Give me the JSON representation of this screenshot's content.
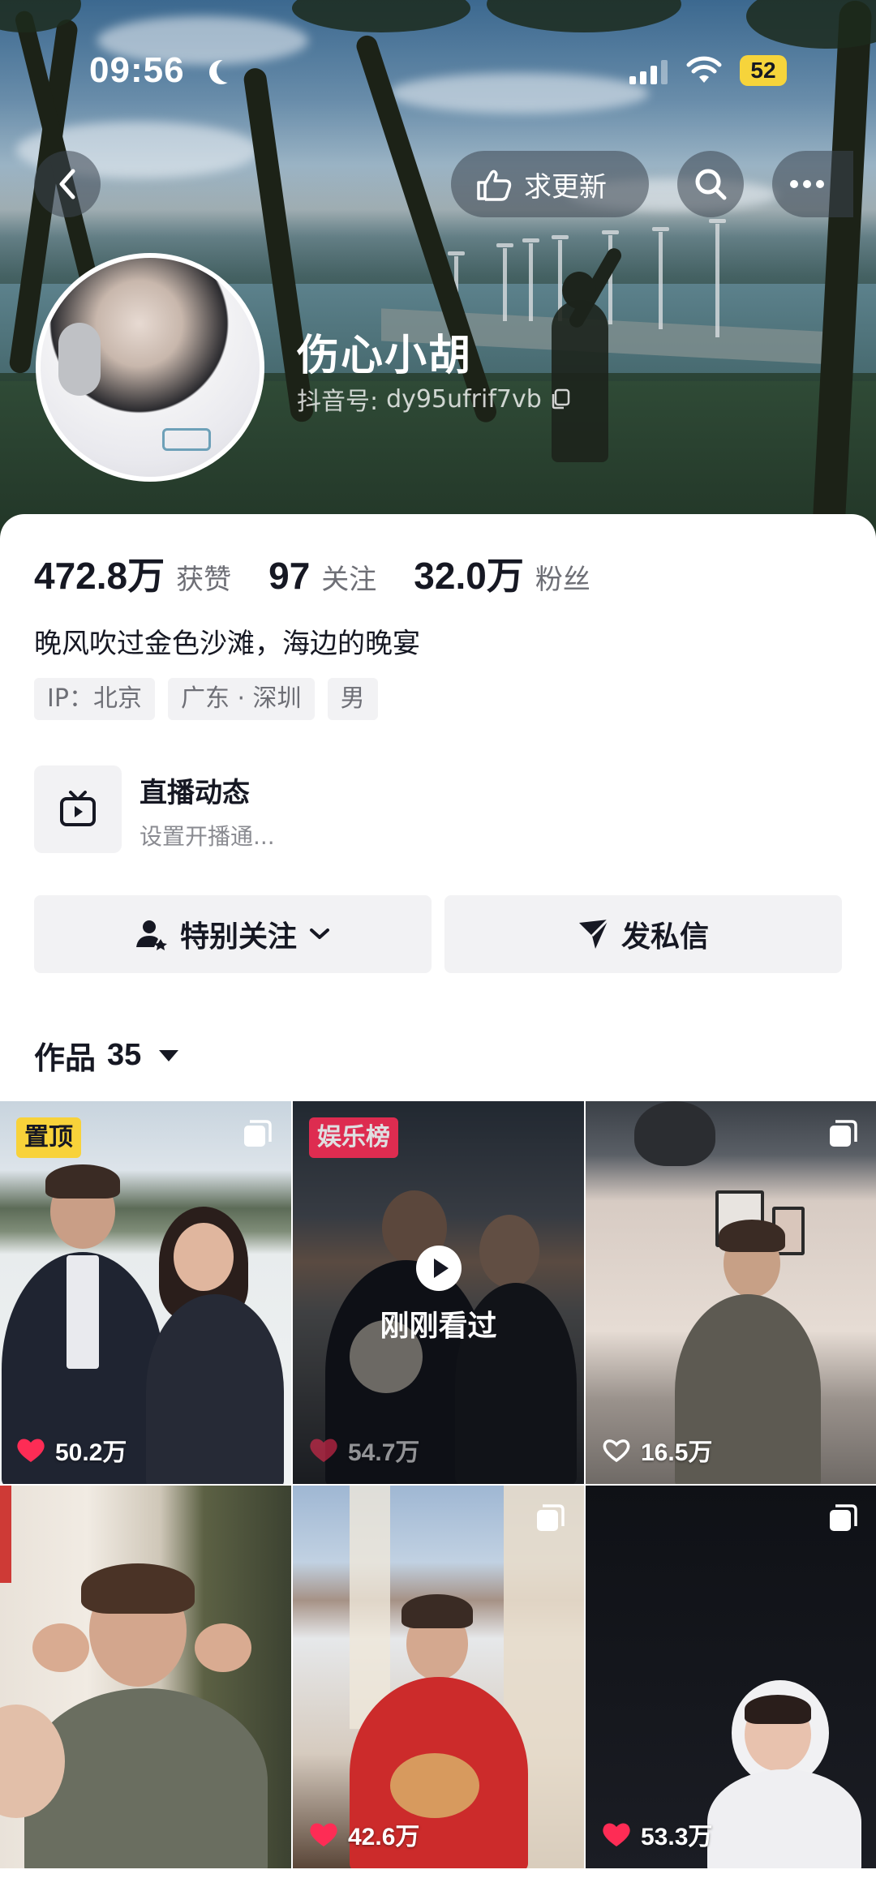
{
  "status_bar": {
    "time": "09:56",
    "battery": "52"
  },
  "header": {
    "update_button_label": "求更新",
    "nickname": "伤心小胡",
    "douyin_id_label": "抖音号:",
    "douyin_id": "dy95ufrif7vb"
  },
  "profile": {
    "stats": [
      {
        "value": "472.8万",
        "label": "获赞"
      },
      {
        "value": "97",
        "label": "关注"
      },
      {
        "value": "32.0万",
        "label": "粉丝"
      }
    ],
    "bio": "晚风吹过金色沙滩，海边的晚宴",
    "tags": [
      "IP：北京",
      "广东 · 深圳",
      "男"
    ],
    "live": {
      "title": "直播动态",
      "subtitle": "设置开播通..."
    },
    "actions": {
      "follow_label": "特别关注",
      "message_label": "发私信"
    },
    "works": {
      "label": "作品",
      "count": "35"
    }
  },
  "videos": [
    {
      "badge": "置顶",
      "likes": "50.2万",
      "liked": true
    },
    {
      "badge": "娱乐榜",
      "likes": "54.7万",
      "liked": true,
      "overlay_text": "刚刚看过"
    },
    {
      "likes": "16.5万",
      "liked": false
    },
    {
      "likes": "",
      "liked": false
    },
    {
      "likes": "42.6万",
      "liked": true
    },
    {
      "likes": "53.3万",
      "liked": true
    }
  ],
  "colors": {
    "accent": "#fe2c55",
    "pin_badge": "#f8d23a",
    "battery": "#f6d43b"
  }
}
